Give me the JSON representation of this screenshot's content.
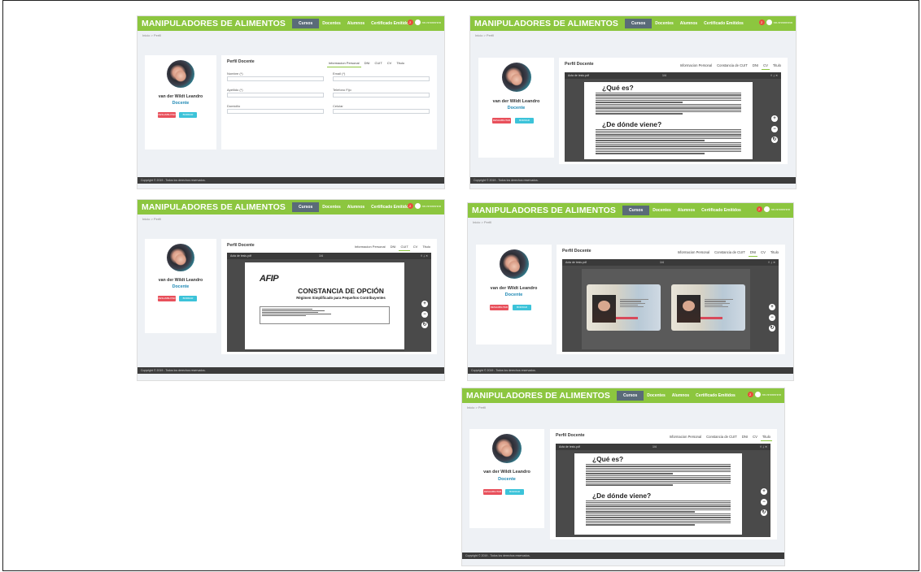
{
  "app": {
    "brand": "MANIPULADORES DE ALIMENTOS",
    "nav": [
      "Cursos",
      "Docentes",
      "Alumnos",
      "Certificado Emitidos"
    ],
    "user": "nn.nnnnnnnn",
    "notif": "2",
    "breadcrumb": "Inicio > Perfil",
    "footer": "Copyright © 2019 - Todos los derechos reservados."
  },
  "profile": {
    "name": "van der Wildt Leandro",
    "role": "Docente",
    "btn_disable": "DESHABILITAR",
    "btn_delete": "BORRAR",
    "title": "Perfil Docente"
  },
  "tabs_form": [
    "Informacion Personal",
    "DNI",
    "CUIT",
    "CV",
    "Titulo"
  ],
  "tabs_full": [
    "Informacion Personal",
    "Constancia de CUIT",
    "DNI",
    "CV",
    "Titulo"
  ],
  "form": {
    "nombre": "Nombre (*)",
    "email": "Email (*)",
    "apellido": "Apellido (*)",
    "telefono": "Telefono Fijo",
    "domicilio": "Domicilio",
    "celular": "Celular"
  },
  "viewer": {
    "file": "Acta de tesis.pdf",
    "page": "1/4"
  },
  "doc": {
    "h1": "¿Qué es?",
    "h2": "¿De dónde viene?"
  },
  "afip": {
    "logo": "AFIP",
    "title": "CONSTANCIA DE OPCIÓN",
    "subtitle": "Régimen Simplificado para Pequeños Contribuyentes"
  }
}
